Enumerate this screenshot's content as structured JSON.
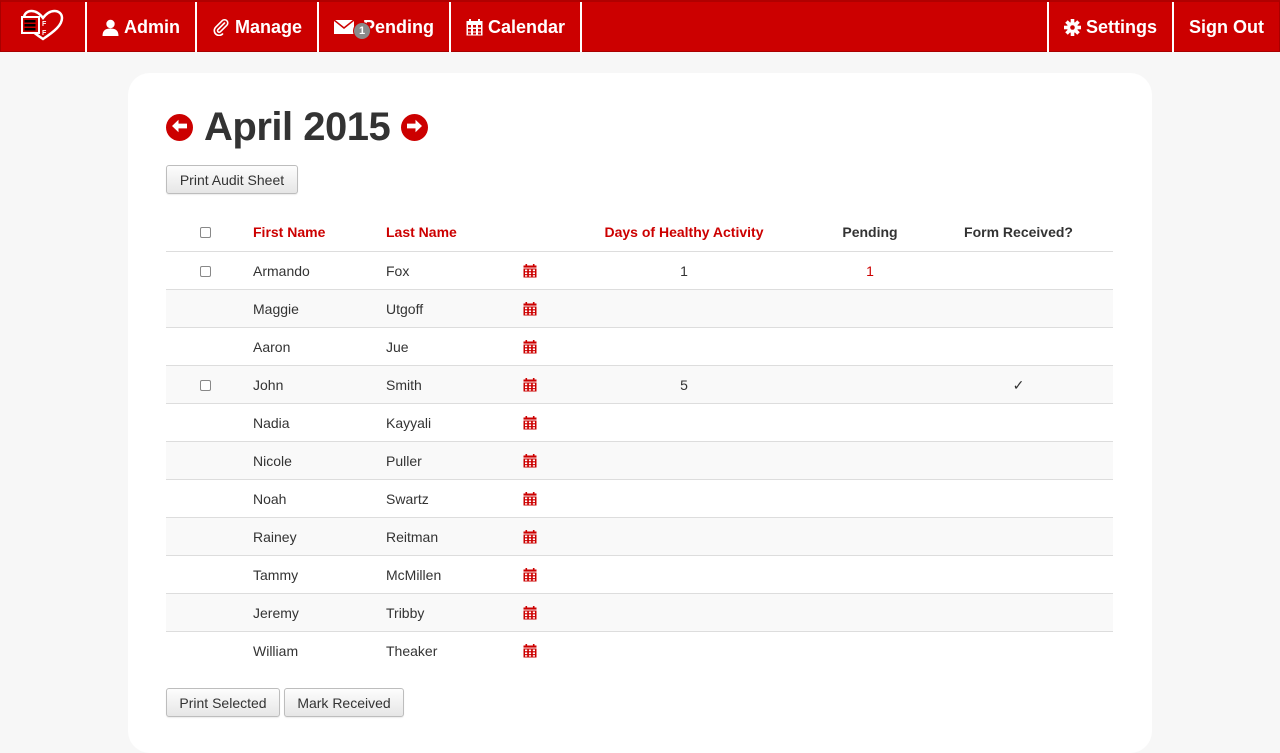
{
  "nav": {
    "brand_icon": "logo-heart-icon",
    "left": [
      {
        "id": "admin",
        "label": "Admin",
        "icon": "user-icon"
      },
      {
        "id": "manage",
        "label": "Manage",
        "icon": "paperclip-icon"
      },
      {
        "id": "pending",
        "label": "Pending",
        "icon": "envelope-icon",
        "badge": "1"
      },
      {
        "id": "calendar",
        "label": "Calendar",
        "icon": "calendar-icon"
      }
    ],
    "right": [
      {
        "id": "settings",
        "label": "Settings",
        "icon": "gear-icon"
      },
      {
        "id": "signout",
        "label": "Sign Out"
      }
    ]
  },
  "page": {
    "month_title": "April 2015",
    "print_audit_label": "Print Audit Sheet",
    "print_selected_label": "Print Selected",
    "mark_received_label": "Mark Received"
  },
  "table": {
    "headers": {
      "first": "First Name",
      "last": "Last Name",
      "days": "Days of Healthy Activity",
      "pending": "Pending",
      "form": "Form Received?"
    },
    "rows": [
      {
        "first": "Armando",
        "last": "Fox",
        "days": "1",
        "pending": "1",
        "form": "",
        "has_checkbox": true
      },
      {
        "first": "Maggie",
        "last": "Utgoff",
        "days": "",
        "pending": "",
        "form": "",
        "has_checkbox": false
      },
      {
        "first": "Aaron",
        "last": "Jue",
        "days": "",
        "pending": "",
        "form": "",
        "has_checkbox": false
      },
      {
        "first": "John",
        "last": "Smith",
        "days": "5",
        "pending": "",
        "form": "✓",
        "has_checkbox": true
      },
      {
        "first": "Nadia",
        "last": "Kayyali",
        "days": "",
        "pending": "",
        "form": "",
        "has_checkbox": false
      },
      {
        "first": "Nicole",
        "last": "Puller",
        "days": "",
        "pending": "",
        "form": "",
        "has_checkbox": false
      },
      {
        "first": "Noah",
        "last": "Swartz",
        "days": "",
        "pending": "",
        "form": "",
        "has_checkbox": false
      },
      {
        "first": "Rainey",
        "last": "Reitman",
        "days": "",
        "pending": "",
        "form": "",
        "has_checkbox": false
      },
      {
        "first": "Tammy",
        "last": "McMillen",
        "days": "",
        "pending": "",
        "form": "",
        "has_checkbox": false
      },
      {
        "first": "Jeremy",
        "last": "Tribby",
        "days": "",
        "pending": "",
        "form": "",
        "has_checkbox": false
      },
      {
        "first": "William",
        "last": "Theaker",
        "days": "",
        "pending": "",
        "form": "",
        "has_checkbox": false
      }
    ]
  },
  "colors": {
    "accent": "#cc0000",
    "stripe": "#f9f9f9",
    "background": "#f7f7f7"
  }
}
